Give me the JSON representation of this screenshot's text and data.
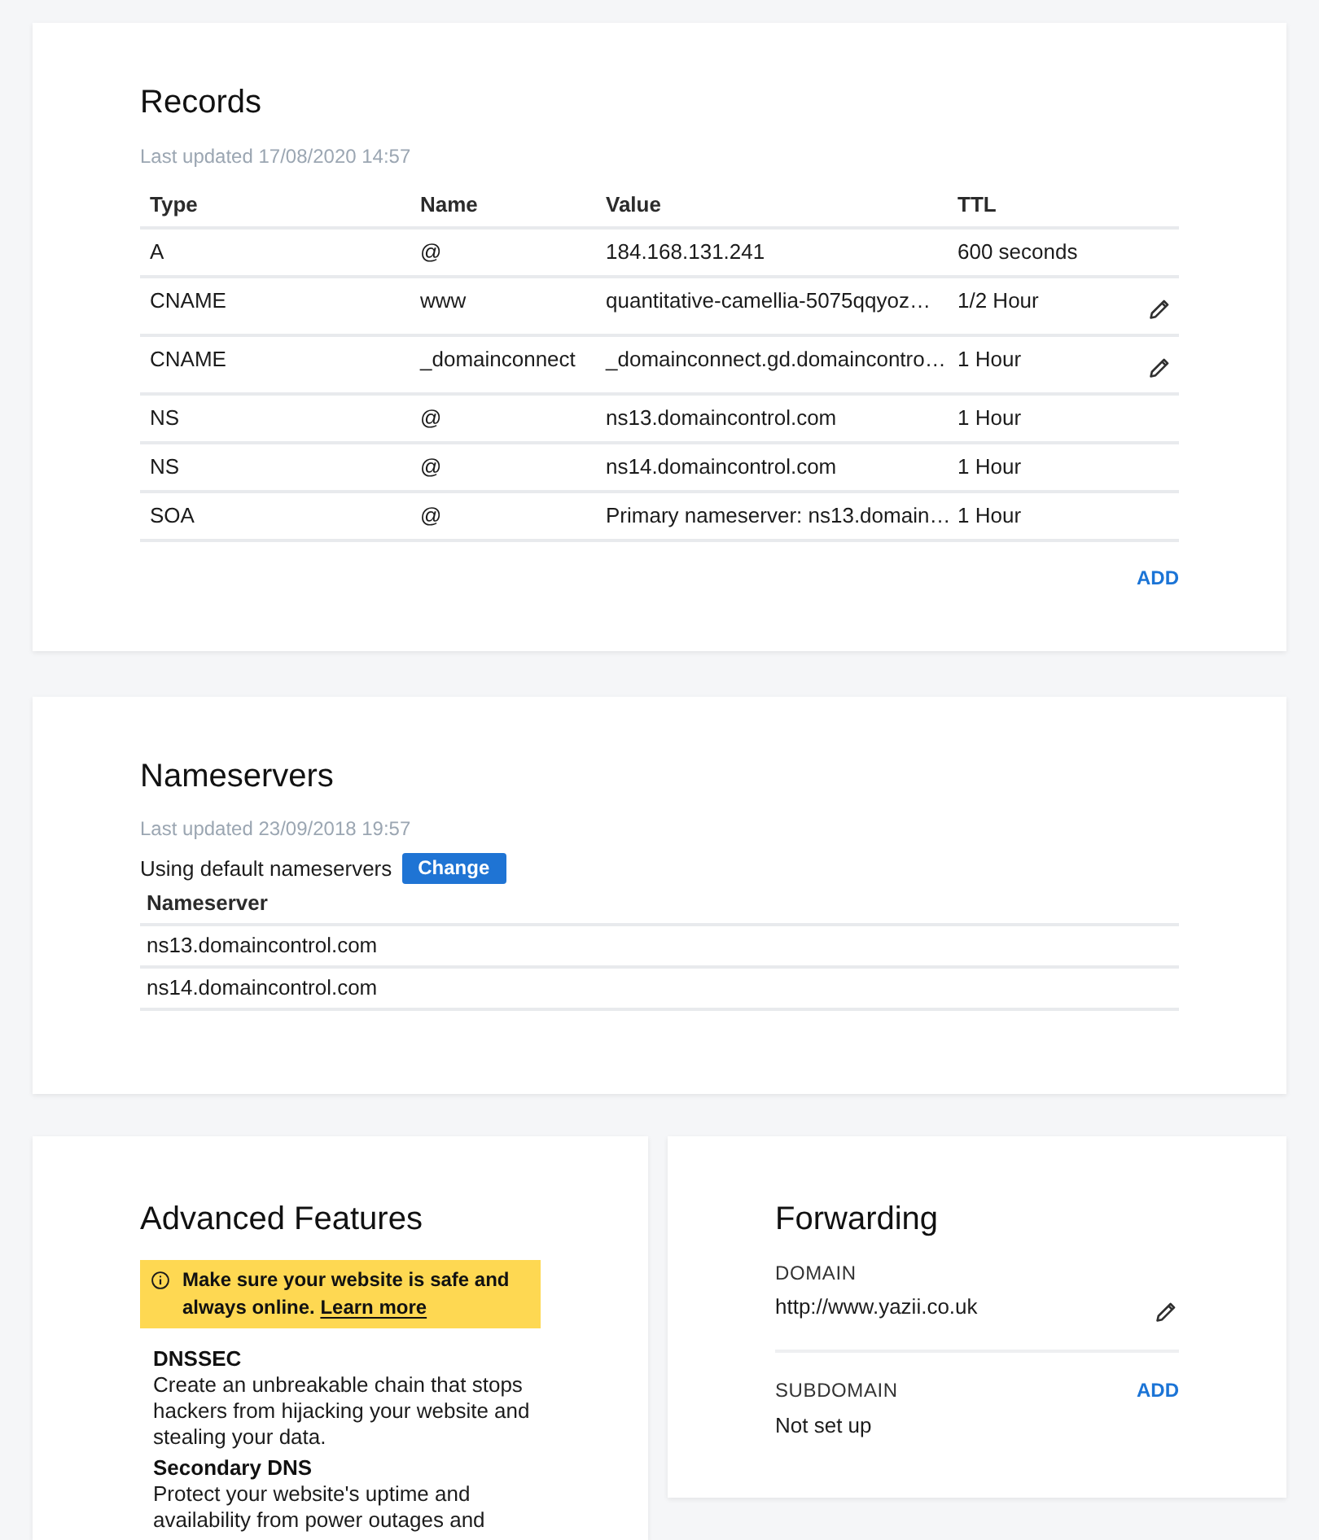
{
  "records": {
    "title": "Records",
    "last_updated": "Last updated 17/08/2020 14:57",
    "columns": [
      "Type",
      "Name",
      "Value",
      "TTL"
    ],
    "rows": [
      {
        "cells": [
          "A",
          "@",
          "184.168.131.241",
          "600 seconds"
        ],
        "editable": false
      },
      {
        "cells": [
          "CNAME",
          "www",
          "quantitative-camellia-5075qqyoz…",
          "1/2 Hour"
        ],
        "editable": true
      },
      {
        "cells": [
          "CNAME",
          "_domainconnect",
          "_domainconnect.gd.domaincontro…",
          "1 Hour"
        ],
        "editable": true
      },
      {
        "cells": [
          "NS",
          "@",
          "ns13.domaincontrol.com",
          "1 Hour"
        ],
        "editable": false
      },
      {
        "cells": [
          "NS",
          "@",
          "ns14.domaincontrol.com",
          "1 Hour"
        ],
        "editable": false
      },
      {
        "cells": [
          "SOA",
          "@",
          "Primary nameserver: ns13.domain…",
          "1 Hour"
        ],
        "editable": false
      }
    ],
    "add_button": "ADD"
  },
  "nameservers": {
    "title": "Nameservers",
    "last_updated": "Last updated 23/09/2018 19:57",
    "status": "Using default nameservers",
    "change_button": "Change",
    "column": "Nameserver",
    "rows": [
      "ns13.domaincontrol.com",
      "ns14.domaincontrol.com"
    ]
  },
  "advanced_features": {
    "title": "Advanced Features",
    "notice": "Make sure your website is safe and always online.",
    "notice_link": "Learn more",
    "features": [
      {
        "name": "DNSSEC",
        "description": "Create an unbreakable chain that stops hackers from hijacking your website and stealing your data."
      },
      {
        "name": "Secondary DNS",
        "description": "Protect your website's uptime and availability from power outages and"
      }
    ]
  },
  "forwarding": {
    "title": "Forwarding",
    "domain": {
      "label": "DOMAIN",
      "value": "http://www.yazii.co.uk",
      "editable": true
    },
    "subdomain": {
      "label": "SUBDOMAIN",
      "value": "Not set up",
      "add_button": "ADD"
    }
  }
}
